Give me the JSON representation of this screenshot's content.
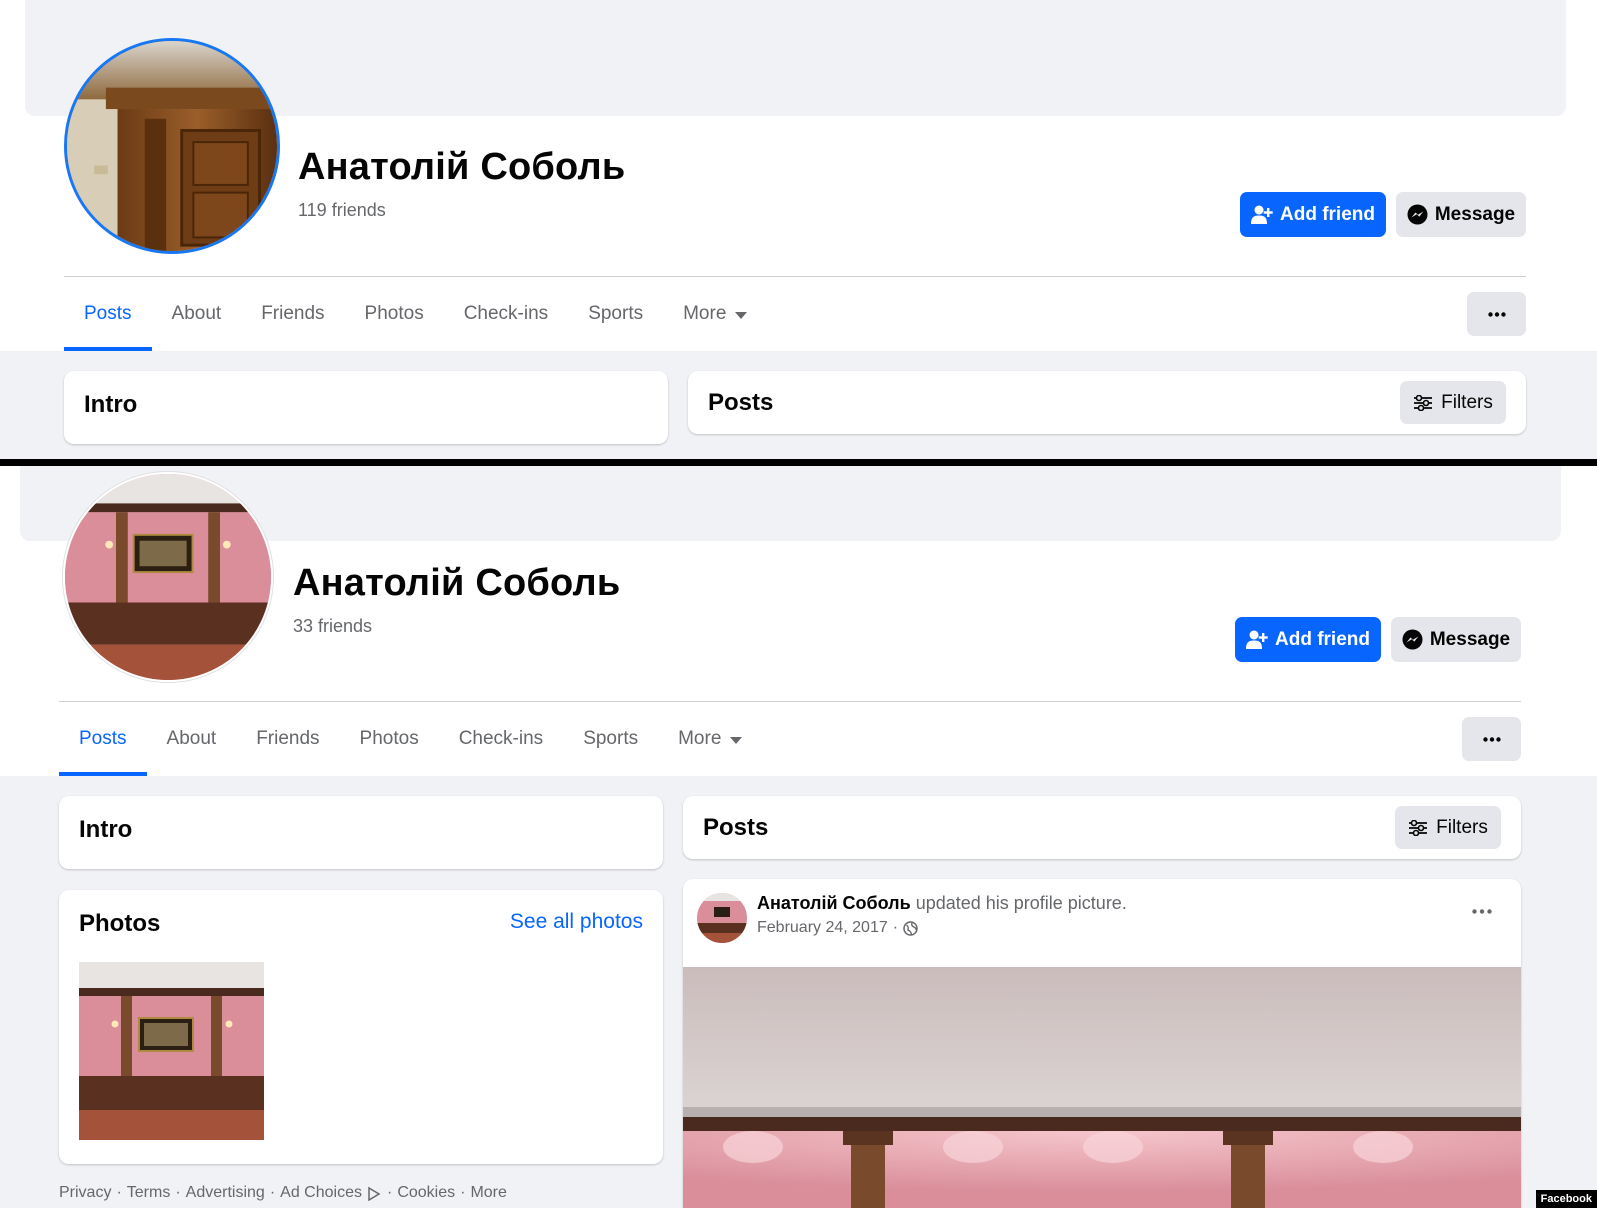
{
  "profiles": [
    {
      "name": "Анатолій Соболь",
      "friends": "119 friends",
      "add_friend": "Add friend",
      "message": "Message",
      "tabs": [
        "Posts",
        "About",
        "Friends",
        "Photos",
        "Check-ins",
        "Sports",
        "More"
      ],
      "intro_title": "Intro",
      "posts_title": "Posts",
      "filters": "Filters"
    },
    {
      "name": "Анатолій Соболь",
      "friends": "33 friends",
      "add_friend": "Add friend",
      "message": "Message",
      "tabs": [
        "Posts",
        "About",
        "Friends",
        "Photos",
        "Check-ins",
        "Sports",
        "More"
      ],
      "intro_title": "Intro",
      "posts_title": "Posts",
      "filters": "Filters",
      "photos_title": "Photos",
      "see_all_photos": "See all photos",
      "footer_links": [
        "Privacy",
        "Terms",
        "Advertising",
        "Ad Choices",
        "Cookies",
        "More"
      ],
      "post": {
        "author": "Анатолій Соболь",
        "action": "updated his profile picture.",
        "date": "February 24, 2017"
      }
    }
  ],
  "watermark": "Facebook",
  "colors": {
    "accent": "#0866ff",
    "grey_bg": "#f0f2f5",
    "button_grey": "#e4e6eb",
    "secondary_text": "#65676b"
  },
  "icons": [
    "add-friend-icon",
    "messenger-icon",
    "more-dots-icon",
    "filters-icon",
    "globe-icon",
    "ad-choices-icon",
    "dropdown-caret-icon"
  ]
}
